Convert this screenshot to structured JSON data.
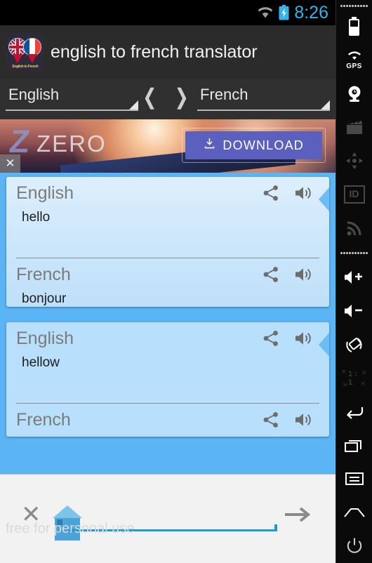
{
  "statusbar": {
    "time": "8:26",
    "wifi_icon": "wifi-icon",
    "battery_icon": "battery-charging-icon"
  },
  "appbar": {
    "title": "english to french translator",
    "icon_name": "app-icon-english-to-french",
    "icon_caption": "English to French"
  },
  "language_row": {
    "source_language": "English",
    "target_language": "French",
    "swap_label": "❬ ❭"
  },
  "ad": {
    "brand_mark": "Z",
    "brand_word": "ZERO",
    "download_label": "DOWNLOAD",
    "download_icon": "download-icon",
    "close_label": "✕",
    "button_color": "#5b5fbe"
  },
  "cards": [
    {
      "source": {
        "language": "English",
        "text": "hello"
      },
      "target": {
        "language": "French",
        "text": "bonjour"
      }
    },
    {
      "source": {
        "language": "English",
        "text": "hellow"
      },
      "target": {
        "language": "French",
        "text": ""
      }
    }
  ],
  "card_icons": {
    "share": "share-icon",
    "speak": "volume-speaker-icon"
  },
  "sheet": {
    "watermark": "free for personal use",
    "close_glyph": "✕",
    "next_glyph": "→",
    "accent_color": "#1b9ad6"
  },
  "sidebar": {
    "items": [
      {
        "name": "battery-icon",
        "label": ""
      },
      {
        "name": "gps-icon",
        "label": "GPS"
      },
      {
        "name": "webcam-icon",
        "label": ""
      },
      {
        "name": "clapperboard-icon",
        "label": ""
      },
      {
        "name": "dpad-icon",
        "label": ""
      },
      {
        "name": "id-icon",
        "label": "ID"
      },
      {
        "name": "rss-icon",
        "label": ""
      },
      {
        "name": "volume-up-icon",
        "label": ""
      },
      {
        "name": "volume-down-icon",
        "label": ""
      },
      {
        "name": "rotate-icon",
        "label": ""
      },
      {
        "name": "scale-one-to-one-icon",
        "label": "1 : 1"
      },
      {
        "name": "back-icon",
        "label": ""
      },
      {
        "name": "recents-icon",
        "label": ""
      },
      {
        "name": "menu-icon",
        "label": ""
      },
      {
        "name": "home-icon",
        "label": ""
      },
      {
        "name": "power-icon",
        "label": ""
      }
    ]
  }
}
